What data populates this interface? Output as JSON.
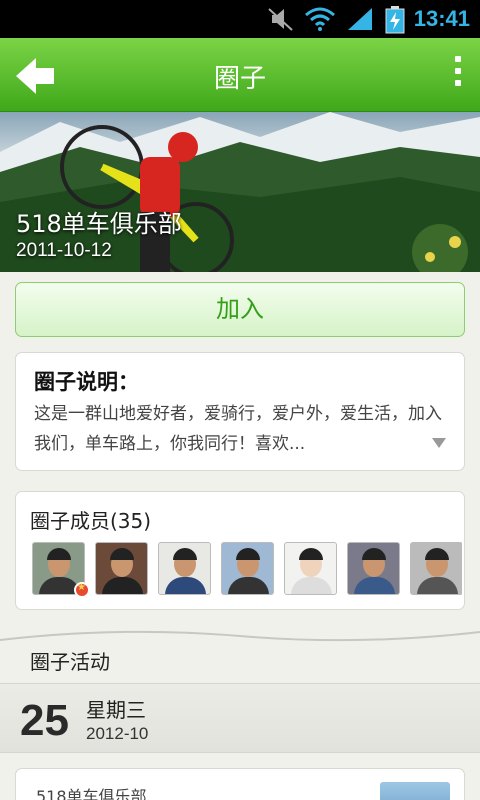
{
  "status_bar": {
    "time": "13:41"
  },
  "action_bar": {
    "title": "圈子"
  },
  "banner": {
    "club_name": "518单车俱乐部",
    "date": "2011-10-12"
  },
  "join_button": {
    "label": "加入"
  },
  "description": {
    "heading": "圈子说明：",
    "text": "这是一群山地爱好者，爱骑行，爱户外，爱生活，加入我们，单车路上，你我同行！喜欢..."
  },
  "members": {
    "heading": "圈子成员(35)",
    "count": 35
  },
  "activity": {
    "heading": "圈子活动",
    "day": "25",
    "weekday": "星期三",
    "year_month": "2012-10",
    "event_title": "518单车俱乐部"
  },
  "colors": {
    "accent": "#4cb824",
    "status_time": "#35b5e5"
  }
}
